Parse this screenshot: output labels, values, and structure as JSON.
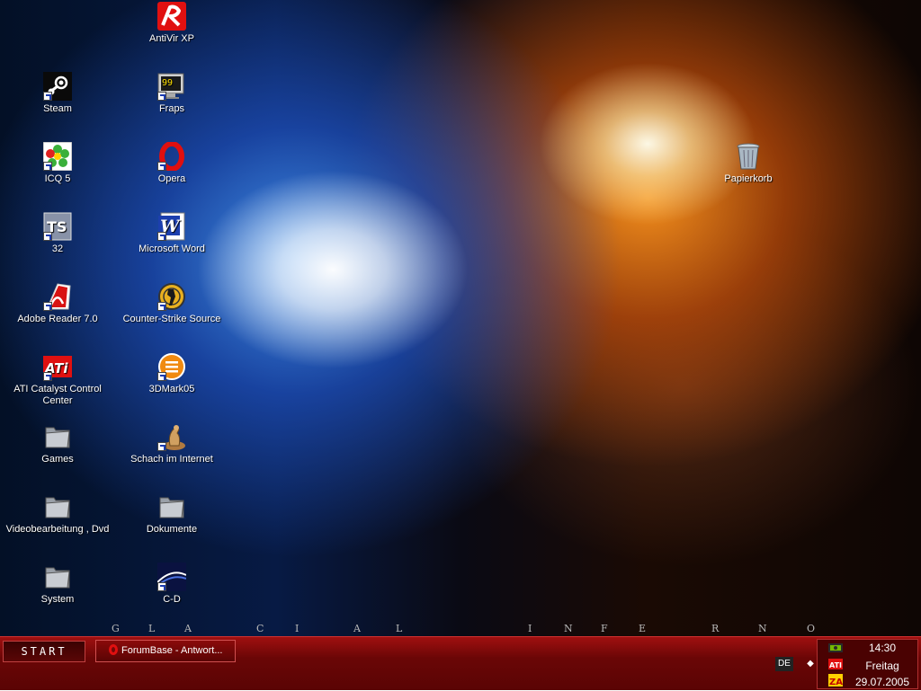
{
  "desktop": {
    "icons": [
      {
        "label": "AntiVir XP",
        "icon": "antivir-umbrella-icon"
      },
      {
        "label": "Steam",
        "icon": "steam-icon"
      },
      {
        "label": "Fraps",
        "icon": "fraps-icon"
      },
      {
        "label": "ICQ 5",
        "icon": "icq-flower-icon"
      },
      {
        "label": "Opera",
        "icon": "opera-icon"
      },
      {
        "label": "Papierkorb",
        "icon": "recycle-bin-icon"
      },
      {
        "label": "32",
        "icon": "ts-icon"
      },
      {
        "label": "Microsoft Word",
        "icon": "word-icon"
      },
      {
        "label": "Adobe Reader 7.0",
        "icon": "adobe-reader-icon"
      },
      {
        "label": "Counter-Strike Source",
        "icon": "counter-strike-icon"
      },
      {
        "label": "ATI Catalyst Control Center",
        "icon": "ati-icon"
      },
      {
        "label": "3DMark05",
        "icon": "3dmark-icon"
      },
      {
        "label": "Games",
        "icon": "folder-icon"
      },
      {
        "label": "Schach im Internet",
        "icon": "chess-icon"
      },
      {
        "label": "Videobearbeitung , Dvd",
        "icon": "folder-icon"
      },
      {
        "label": "Dokumente",
        "icon": "folder-icon"
      },
      {
        "label": "System",
        "icon": "folder-icon"
      },
      {
        "label": "C-D",
        "icon": "c-d-icon"
      }
    ],
    "fraps_counter": "99",
    "ati_logo_text": "ATi",
    "ts_text": "TS",
    "word_letter": "W"
  },
  "wallpaper": {
    "letters": [
      "G",
      "L",
      "A",
      "C",
      "I",
      "A",
      "L",
      "I",
      "N",
      "F",
      "E",
      "R",
      "N",
      "O"
    ]
  },
  "taskbar": {
    "start_label": "START",
    "task_label": "ForumBase - Antwort...",
    "language": "DE",
    "tray_arrow": "◆",
    "clock_time": "14:30",
    "clock_day": "Freitag",
    "clock_date": "29.07.2005",
    "tray_icons": [
      "nvidia-tray-icon",
      "ati-tray-icon",
      "zonealarm-tray-icon"
    ],
    "tray_ati_text": "ATI",
    "tray_za_text": "ZA"
  },
  "colors": {
    "taskbar_red": "#6a0606",
    "taskbar_border": "#d03030",
    "icon_text": "#ffffff"
  }
}
